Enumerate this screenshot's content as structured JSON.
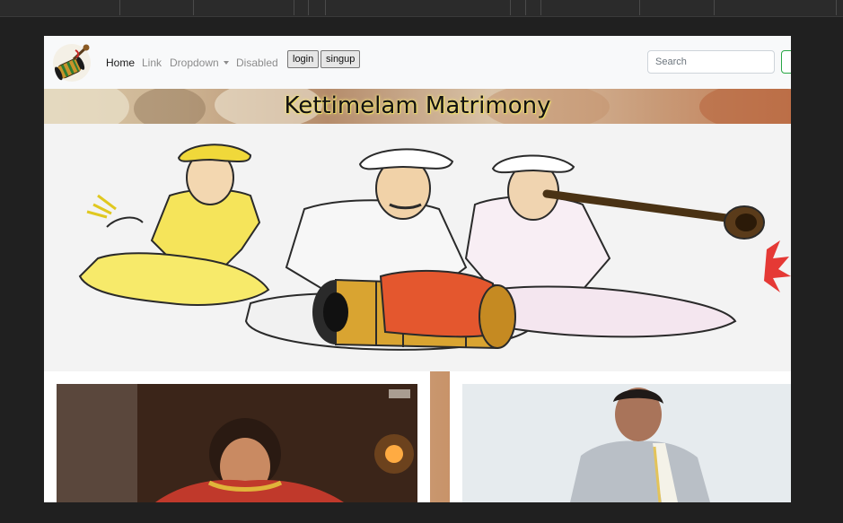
{
  "navbar": {
    "brand_icon": "drum-and-nadaswaram-icon",
    "links": [
      {
        "label": "Home",
        "state": "active"
      },
      {
        "label": "Link",
        "state": "normal"
      },
      {
        "label": "Dropdown",
        "state": "dropdown"
      },
      {
        "label": "Disabled",
        "state": "disabled"
      }
    ],
    "login_label": "login",
    "signup_label": "singup",
    "search": {
      "placeholder": "Search",
      "value": ""
    }
  },
  "banner": {
    "title": "Kettimelam Matrimony"
  },
  "hero": {
    "image": "illustration of three traditional musicians playing drum and nadaswaram"
  },
  "cards": [
    {
      "image": "bride in red silk saree with gold jewellery"
    },
    {
      "image": "groom in silver silk shirt with white veshti"
    }
  ],
  "colors": {
    "nav_bg": "#f8f9fa",
    "banner_title_glow": "#f2e37a",
    "search_button_border": "#28a745",
    "window_bg": "#202020"
  }
}
